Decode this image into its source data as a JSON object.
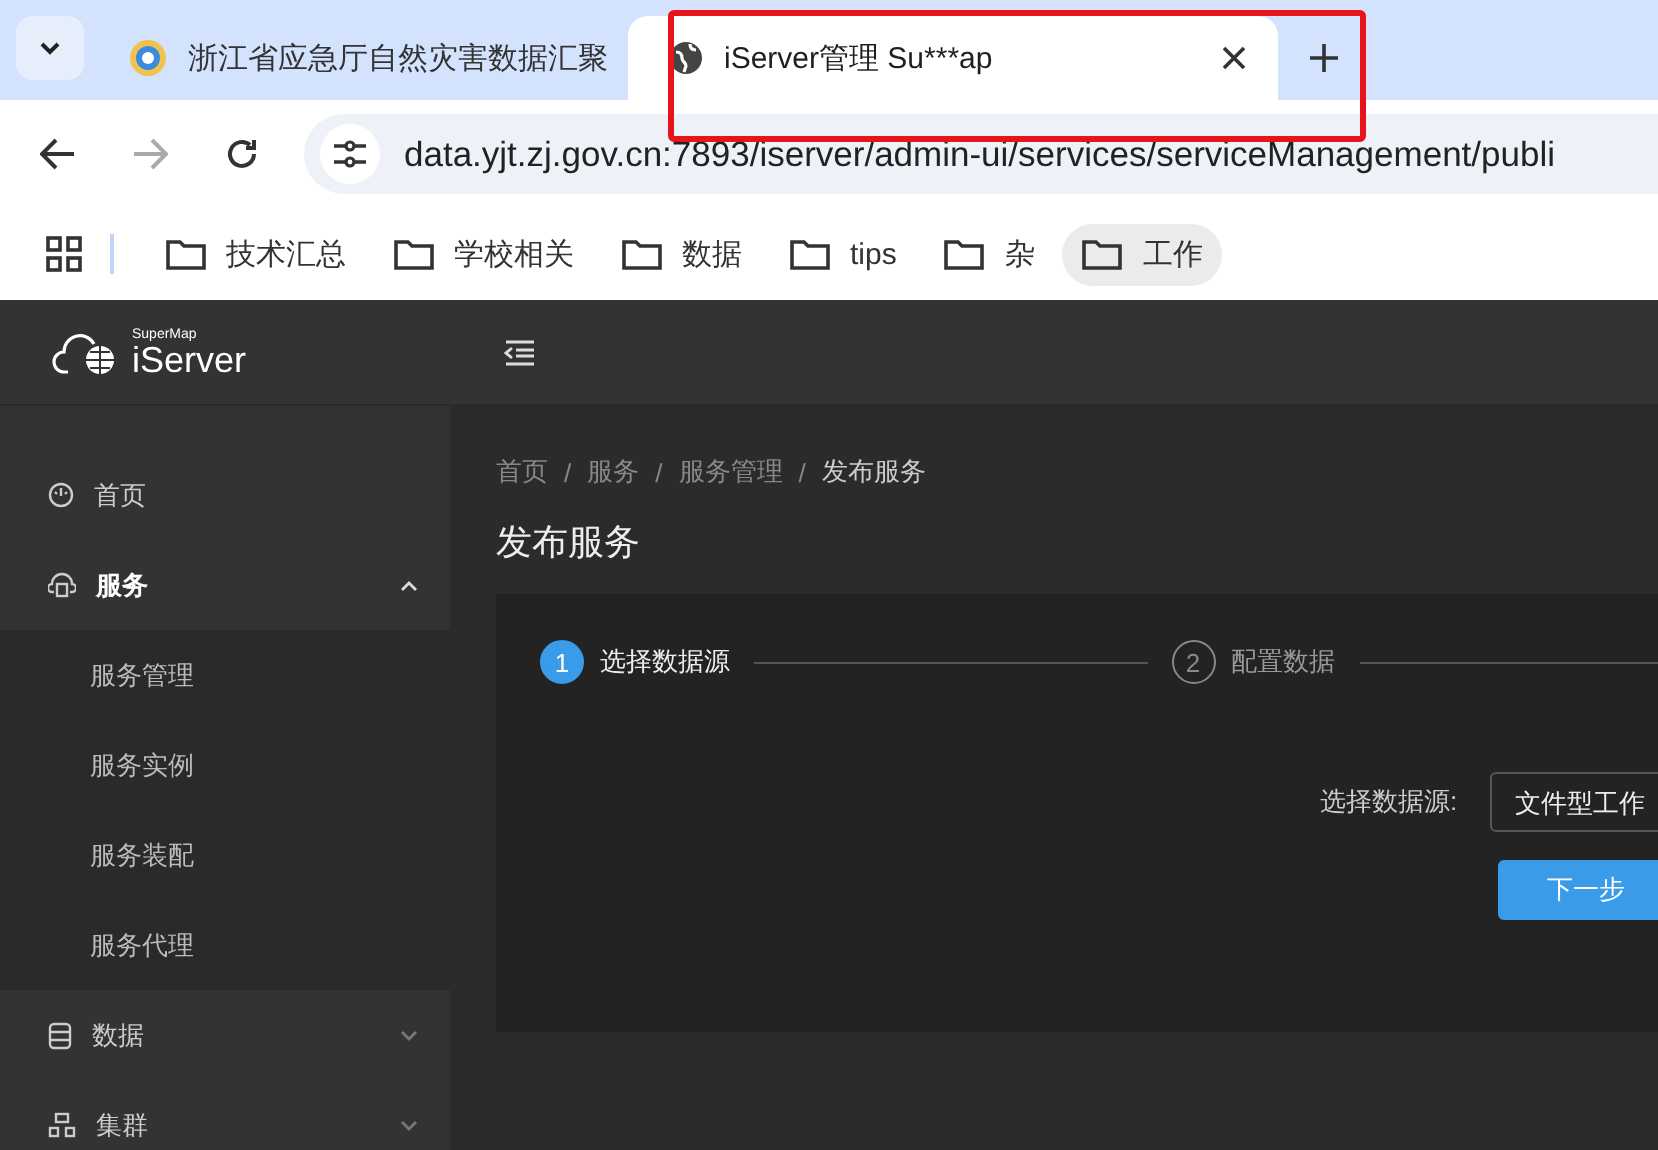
{
  "browser": {
    "tabs": [
      {
        "kind": "emblem",
        "title": "浙江省应急厅自然灾害数据汇聚",
        "selected": false
      },
      {
        "kind": "globe",
        "title": "iServer管理 Su***ap",
        "selected": true
      }
    ],
    "address": "data.yjt.zj.gov.cn:7893/iserver/admin-ui/services/serviceManagement/publi",
    "bookmarks": [
      {
        "label": "技术汇总",
        "highlighted": false
      },
      {
        "label": "学校相关",
        "highlighted": false
      },
      {
        "label": "数据",
        "highlighted": false
      },
      {
        "label": "tips",
        "highlighted": false
      },
      {
        "label": "杂",
        "highlighted": false
      },
      {
        "label": "工作",
        "highlighted": true
      }
    ]
  },
  "logo": {
    "small": "SuperMap",
    "main": "iServer"
  },
  "sidebar": {
    "items": [
      {
        "kind": "home",
        "label": "首页",
        "selected": false
      },
      {
        "kind": "service",
        "label": "服务",
        "selected": true,
        "expanded": true,
        "children": [
          {
            "label": "服务管理"
          },
          {
            "label": "服务实例"
          },
          {
            "label": "服务装配"
          },
          {
            "label": "服务代理"
          }
        ]
      },
      {
        "kind": "data",
        "label": "数据",
        "selected": false,
        "expanded": false
      },
      {
        "kind": "cluster",
        "label": "集群",
        "selected": false,
        "expanded": false
      }
    ]
  },
  "breadcrumb": [
    {
      "label": "首页"
    },
    {
      "separator": "/",
      "label": "服务"
    },
    {
      "separator": "/",
      "label": "服务管理"
    },
    {
      "separator": "/",
      "label": "发布服务"
    }
  ],
  "page_title": "发布服务",
  "steps": [
    {
      "number": "1",
      "label": "选择数据源",
      "selected": true
    },
    {
      "number": "2",
      "label": "配置数据",
      "selected": false
    }
  ],
  "form": {
    "label": "选择数据源:",
    "value": "文件型工作"
  },
  "next_button": "下一步"
}
